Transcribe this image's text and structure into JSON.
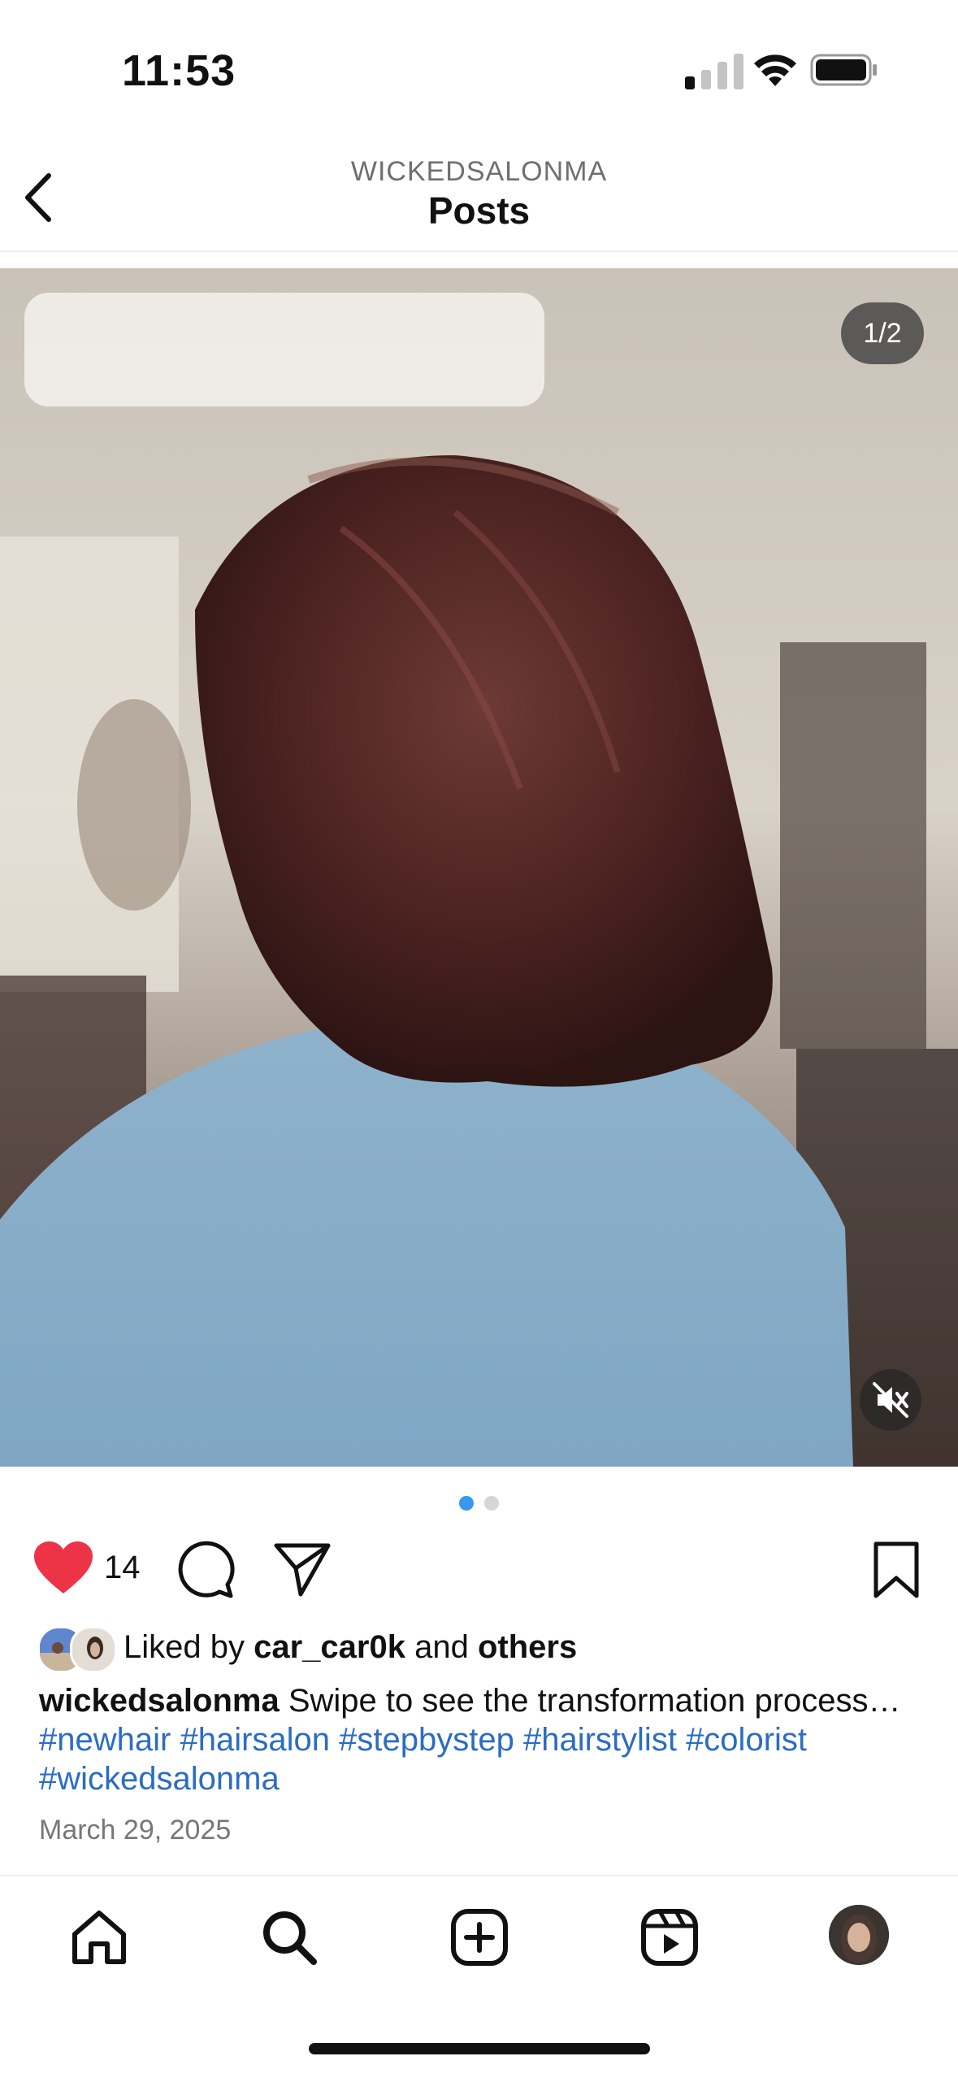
{
  "status_bar": {
    "time": "11:53"
  },
  "header": {
    "account": "WICKEDSALONMA",
    "title": "Posts"
  },
  "post": {
    "image_counter": "1/2",
    "page_index": 1,
    "page_total": 2,
    "likes_count": "14",
    "liked_by": {
      "prefix": "Liked by",
      "user": "car_car0k",
      "conj": "and",
      "others": "others"
    },
    "caption": {
      "username": "wickedsalonma",
      "text": "Swipe to see the transformation process…",
      "hashtags": [
        "#newhair",
        "#hairsalon",
        "#stepbystep",
        "#hairstylist",
        "#colorist",
        "#wickedsalonma"
      ]
    },
    "date": "March 29, 2025",
    "liked": true
  },
  "nav": {
    "items": [
      "home-icon",
      "search-icon",
      "create-icon",
      "reels-icon",
      "profile-avatar"
    ]
  },
  "colors": {
    "like": "#ed3447",
    "accent": "#3897f0",
    "hashtag": "#2b6cc4"
  }
}
